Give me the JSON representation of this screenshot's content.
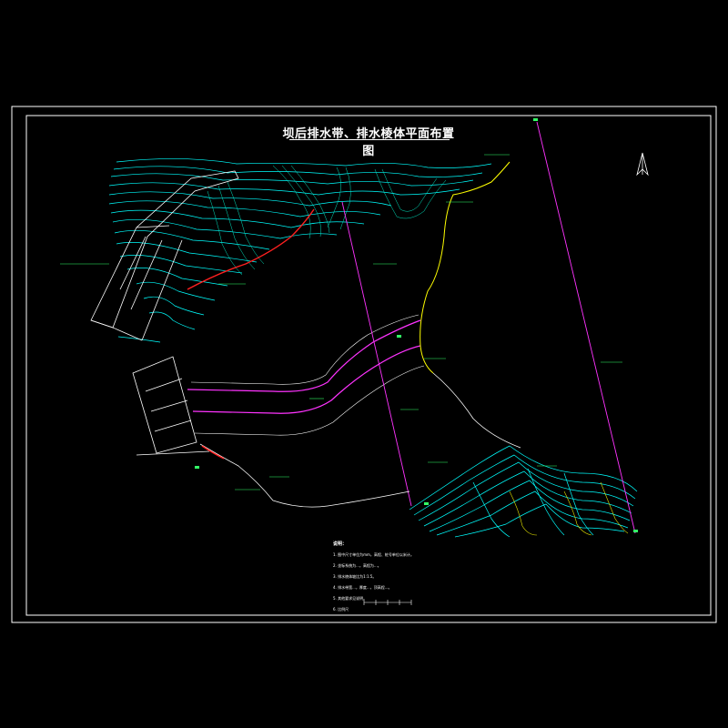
{
  "title": "坝后排水带、排水棱体平面布置图",
  "notes": {
    "heading": "说明：",
    "items": [
      "1. 图中尺寸单位为mm，高程、桩号单位以米计。",
      "2. 坐标系统为...，高程为...。",
      "3. 排水棱体坡比为1:1.5。",
      "4. 排水带宽...，厚度...，顶高程...。",
      "5. 其他要求见说明。",
      "6. 比例尺"
    ]
  },
  "colors": {
    "background": "#000000",
    "frame": "#ffffff",
    "contour": "#00ffff",
    "contour_alt": "#00e5c0",
    "boundary_red": "#ff2020",
    "section_line": "#ff33ff",
    "road_yellow": "#ffff00",
    "label_green": "#33ff66",
    "dam": "#ffffff"
  },
  "icons": {
    "north": "north-arrow-icon"
  }
}
